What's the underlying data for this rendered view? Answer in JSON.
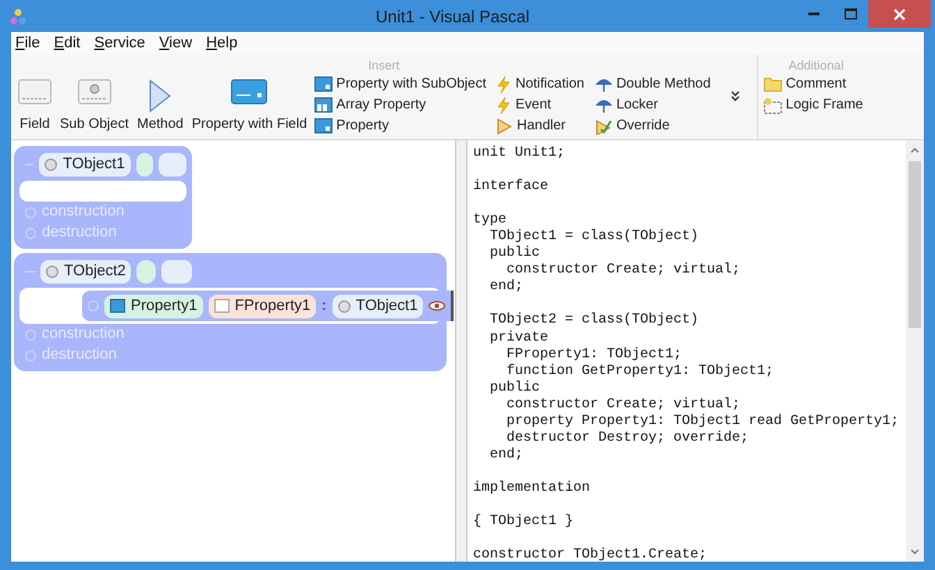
{
  "window": {
    "title": "Unit1 - Visual Pascal"
  },
  "menu": [
    "File",
    "Edit",
    "Service",
    "View",
    "Help"
  ],
  "ribbon": {
    "groups": [
      {
        "title": "Insert",
        "large": [
          {
            "label": "Field",
            "kind": "field"
          },
          {
            "label": "Sub Object",
            "kind": "subobject"
          },
          {
            "label": "Method",
            "kind": "method"
          },
          {
            "label": "Property with Field",
            "kind": "propfield"
          }
        ],
        "columns": [
          [
            {
              "label": "Property with SubObject",
              "kind": "property"
            },
            {
              "label": "Array Property",
              "kind": "array"
            },
            {
              "label": "Property",
              "kind": "property"
            }
          ],
          [
            {
              "label": "Notification",
              "kind": "bolt"
            },
            {
              "label": "Event",
              "kind": "bolt"
            },
            {
              "label": "Handler",
              "kind": "handler"
            }
          ],
          [
            {
              "label": "Double Method",
              "kind": "umbrella"
            },
            {
              "label": "Locker",
              "kind": "umbrella"
            },
            {
              "label": "Override",
              "kind": "override"
            }
          ]
        ],
        "more": true
      },
      {
        "title": "Additional",
        "columns": [
          [
            {
              "label": "Comment",
              "kind": "comment"
            },
            {
              "label": "Logic Frame",
              "kind": "frame"
            }
          ]
        ]
      }
    ]
  },
  "diagram": {
    "classes": [
      {
        "name": "TObject1",
        "sections": [
          "construction",
          "destruction"
        ]
      },
      {
        "name": "TObject2",
        "members": [
          {
            "name": "Property1",
            "field": "FProperty1",
            "separator": ":",
            "type": "TObject1"
          }
        ],
        "sections": [
          "construction",
          "destruction"
        ]
      }
    ]
  },
  "code": [
    [
      "unit Unit1;"
    ],
    [
      "interface"
    ],
    [
      "type",
      "  TObject1 = class(TObject)",
      "  public",
      "    constructor Create; virtual;",
      "  end;"
    ],
    [
      "  TObject2 = class(TObject)",
      "  private",
      "    FProperty1: TObject1;",
      "    function GetProperty1: TObject1;",
      "  public",
      "    constructor Create; virtual;",
      "    property Property1: TObject1 read GetProperty1;",
      "    destructor Destroy; override;",
      "  end;"
    ],
    [
      "implementation"
    ],
    [
      "{ TObject1 }"
    ],
    [
      "constructor TObject1.Create;"
    ]
  ]
}
